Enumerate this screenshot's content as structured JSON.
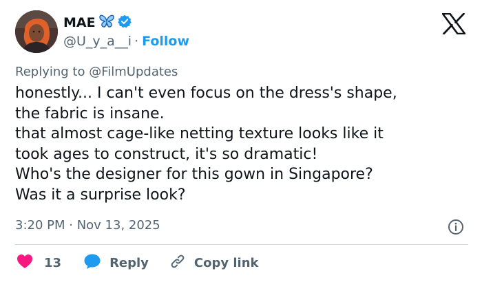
{
  "author": {
    "display_name": "MAE",
    "handle": "@U_y_a__i",
    "separator": "·",
    "follow_label": "Follow"
  },
  "reply": {
    "prefix": "Replying to",
    "mention": "@FilmUpdates"
  },
  "tweet": {
    "lines": [
      "honestly... I can't even focus on the dress's shape,",
      "the fabric is insane.",
      "that almost cage-like netting texture looks like it",
      "took ages to construct, it's so dramatic!",
      "Who's the designer for this gown in Singapore?",
      "Was it a surprise look?"
    ]
  },
  "meta": {
    "timestamp": "3:20 PM · Nov 13, 2025"
  },
  "actions": {
    "like_count": "13",
    "reply_label": "Reply",
    "copy_link_label": "Copy link"
  },
  "icons": {
    "emoji": "butterfly-icon",
    "verified": "verified-badge-icon",
    "logo": "x-logo-icon",
    "info": "info-icon",
    "like": "heart-icon",
    "reply": "reply-bubble-icon",
    "copy": "link-icon"
  },
  "colors": {
    "text": "#0f1419",
    "secondary": "#536471",
    "accent": "#1d9bf0",
    "like": "#f91880",
    "divider": "#cfd9de"
  }
}
